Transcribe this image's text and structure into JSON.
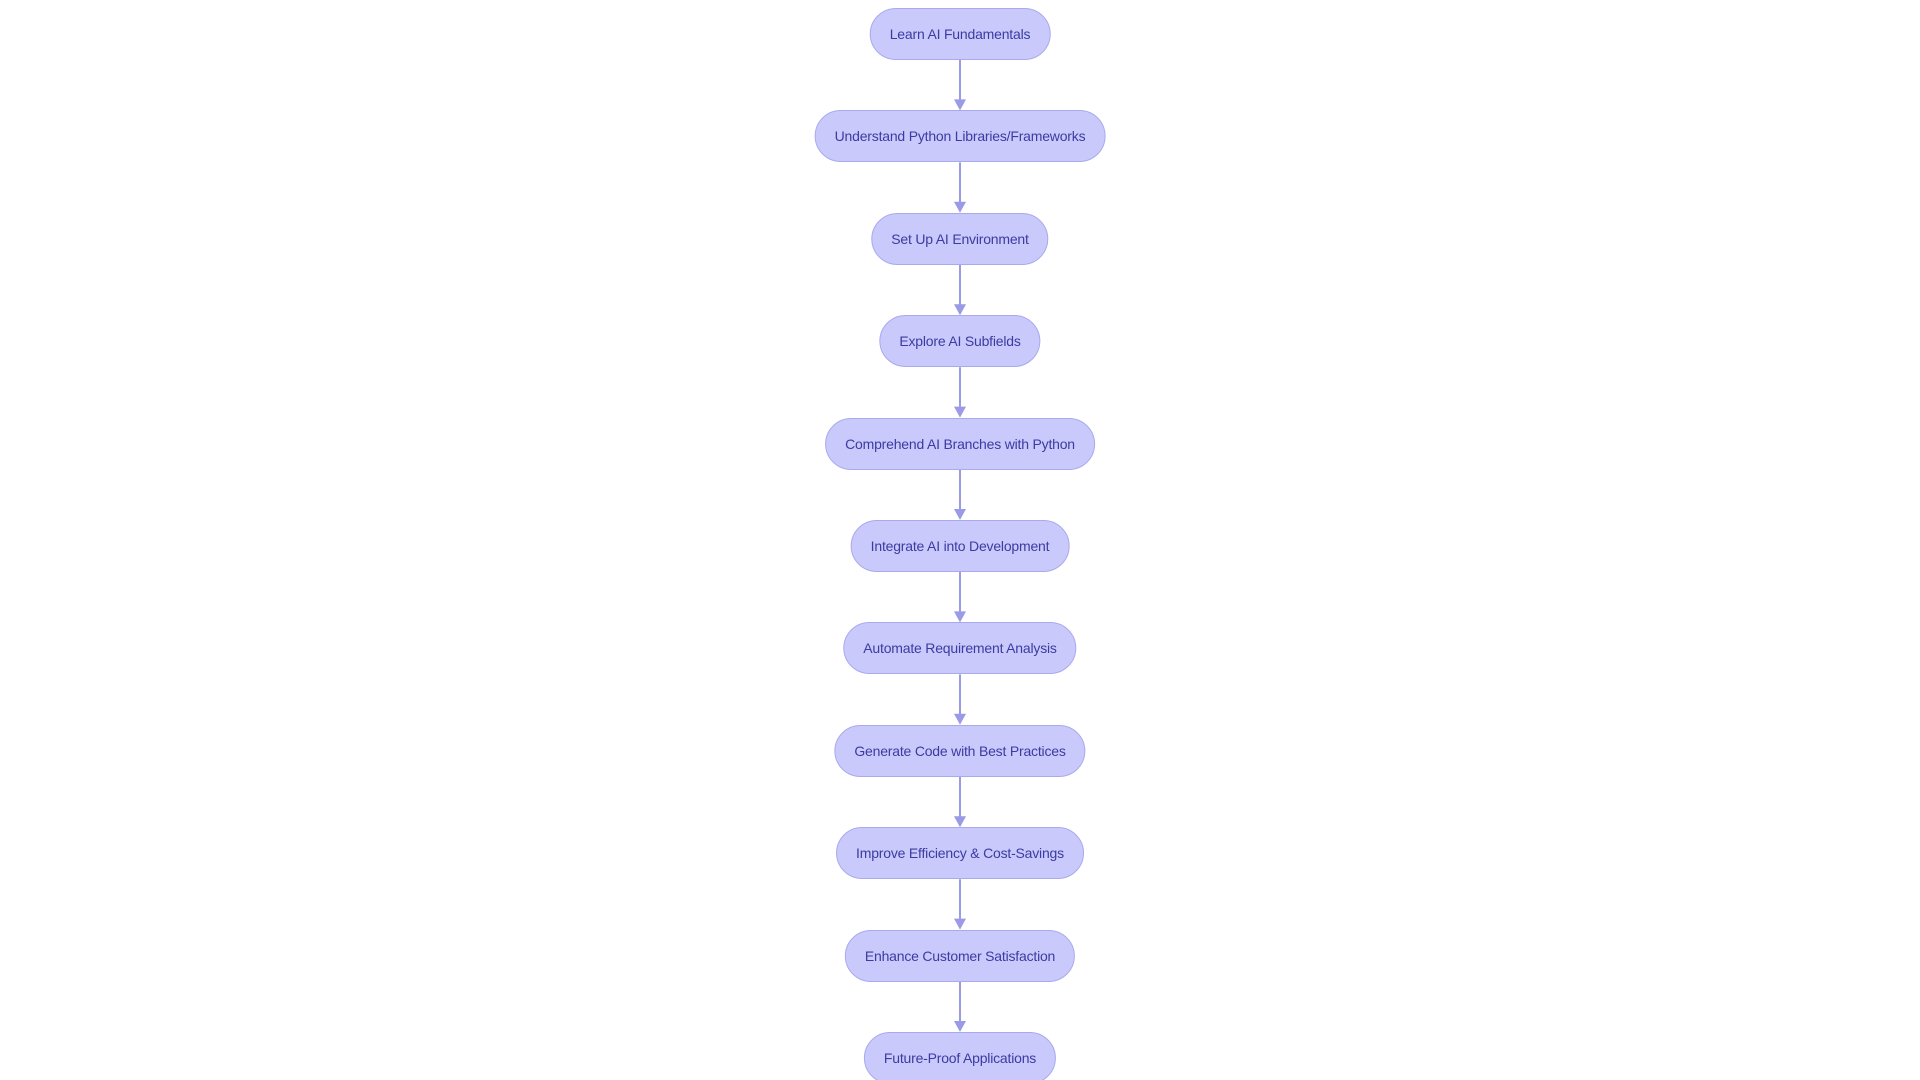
{
  "diagram": {
    "type": "flowchart",
    "direction": "top-to-bottom",
    "colors": {
      "background": "#ffffff",
      "node_fill": "#c9c9fb",
      "node_border": "#a9a9ee",
      "node_text": "#3b3ba3",
      "edge": "#9a9ae6"
    },
    "nodes": [
      {
        "id": "n1",
        "label": "Learn AI Fundamentals"
      },
      {
        "id": "n2",
        "label": "Understand Python Libraries/Frameworks"
      },
      {
        "id": "n3",
        "label": "Set Up AI Environment"
      },
      {
        "id": "n4",
        "label": "Explore AI Subfields"
      },
      {
        "id": "n5",
        "label": "Comprehend AI Branches with Python"
      },
      {
        "id": "n6",
        "label": "Integrate AI into Development"
      },
      {
        "id": "n7",
        "label": "Automate Requirement Analysis"
      },
      {
        "id": "n8",
        "label": "Generate Code with Best Practices"
      },
      {
        "id": "n9",
        "label": "Improve Efficiency & Cost-Savings"
      },
      {
        "id": "n10",
        "label": "Enhance Customer Satisfaction"
      },
      {
        "id": "n11",
        "label": "Future-Proof Applications"
      }
    ],
    "edges": [
      {
        "from": "n1",
        "to": "n2"
      },
      {
        "from": "n2",
        "to": "n3"
      },
      {
        "from": "n3",
        "to": "n4"
      },
      {
        "from": "n4",
        "to": "n5"
      },
      {
        "from": "n5",
        "to": "n6"
      },
      {
        "from": "n6",
        "to": "n7"
      },
      {
        "from": "n7",
        "to": "n8"
      },
      {
        "from": "n8",
        "to": "n9"
      },
      {
        "from": "n9",
        "to": "n10"
      },
      {
        "from": "n10",
        "to": "n11"
      }
    ]
  }
}
